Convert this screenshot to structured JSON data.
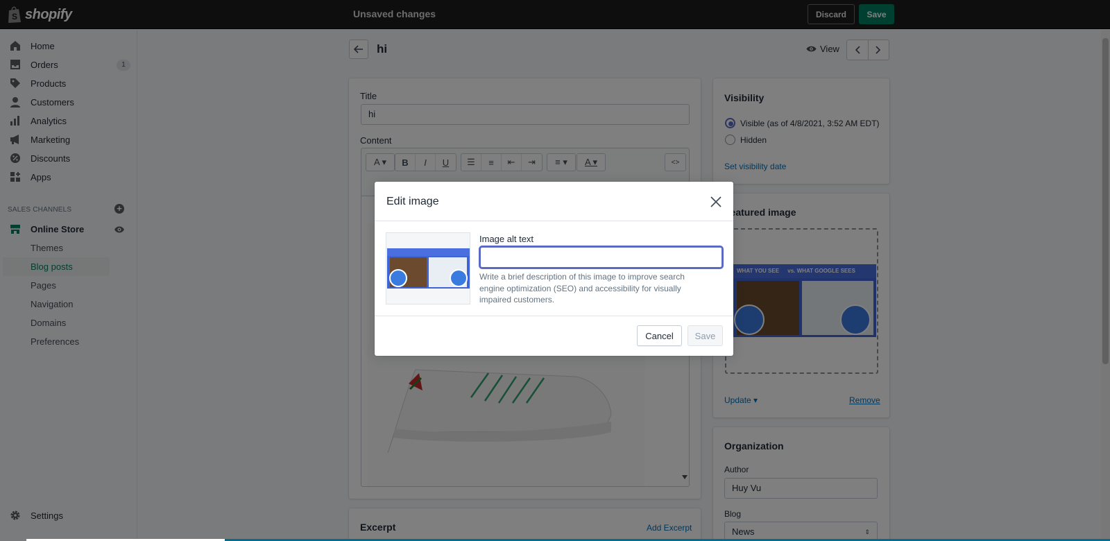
{
  "topbar": {
    "logo_text": "shopify",
    "status": "Unsaved changes",
    "discard_label": "Discard",
    "save_label": "Save"
  },
  "sidebar": {
    "items": [
      {
        "label": "Home",
        "icon": "home-icon"
      },
      {
        "label": "Orders",
        "icon": "orders-icon",
        "badge": "1"
      },
      {
        "label": "Products",
        "icon": "tag-icon"
      },
      {
        "label": "Customers",
        "icon": "person-icon"
      },
      {
        "label": "Analytics",
        "icon": "bar-chart-icon"
      },
      {
        "label": "Marketing",
        "icon": "megaphone-icon"
      },
      {
        "label": "Discounts",
        "icon": "discount-icon"
      },
      {
        "label": "Apps",
        "icon": "apps-icon"
      }
    ],
    "sales_channels_heading": "SALES CHANNELS",
    "online_store": "Online Store",
    "sub_items": [
      "Themes",
      "Blog posts",
      "Pages",
      "Navigation",
      "Domains",
      "Preferences"
    ],
    "active_sub": "Blog posts",
    "settings": "Settings"
  },
  "page": {
    "title": "hi",
    "view_label": "View"
  },
  "post": {
    "title_label": "Title",
    "title_value": "hi",
    "content_label": "Content"
  },
  "visibility": {
    "heading": "Visibility",
    "visible_label": "Visible (as of 4/8/2021, 3:52 AM EDT)",
    "hidden_label": "Hidden",
    "selected": "visible",
    "set_date_link": "Set visibility date"
  },
  "featured_image": {
    "heading": "Featured image",
    "update_label": "Update",
    "remove_label": "Remove",
    "banner_left": "WHAT YOU SEE",
    "banner_right": "vs. WHAT GOOGLE SEES"
  },
  "organization": {
    "heading": "Organization",
    "author_label": "Author",
    "author_value": "Huy Vu",
    "blog_label": "Blog",
    "blog_value": "News"
  },
  "excerpt": {
    "heading": "Excerpt",
    "add_link": "Add Excerpt"
  },
  "modal": {
    "title": "Edit image",
    "alt_label": "Image alt text",
    "alt_value": "",
    "help_text": "Write a brief description of this image to improve search engine optimization (SEO) and accessibility for visually impaired customers.",
    "cancel_label": "Cancel",
    "save_label": "Save"
  },
  "colors": {
    "primary_green": "#008060",
    "focus_indigo": "#5c6ac4",
    "link_blue": "#006fbb",
    "topbar_bg": "#1c1c1c"
  }
}
